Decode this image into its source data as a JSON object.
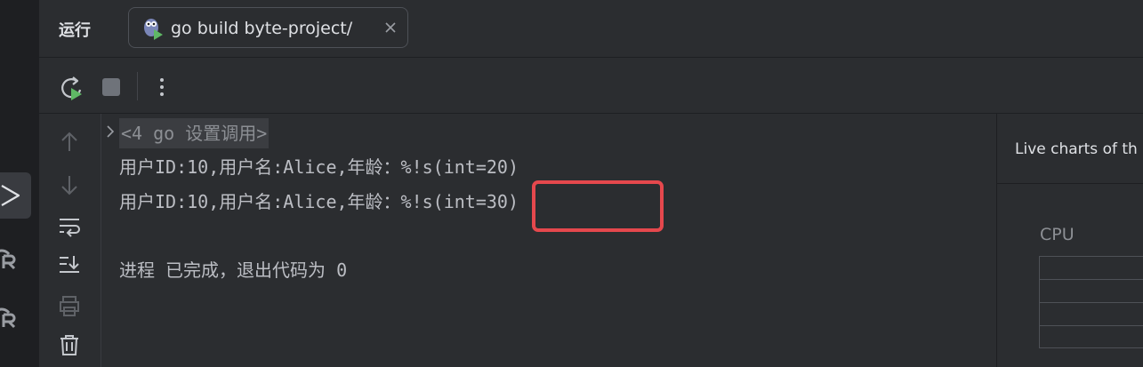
{
  "run_panel": {
    "title": "运行",
    "tab": {
      "label": "go build byte-project/"
    }
  },
  "console": {
    "collapsed_block": "<4 go 设置调用>",
    "lines": [
      "用户ID:10,用户名:Alice,年龄：%!s(int=20)",
      "用户ID:10,用户名:Alice,年龄：%!s(int=30)",
      "进程 已完成，退出代码为 0"
    ]
  },
  "live_charts": {
    "title": "Live charts of th",
    "cpu_label": "CPU"
  },
  "icons": {
    "left_strip": [
      "run-tool-window-icon",
      "coderabbit-icon",
      "coderabbit-icon"
    ],
    "toolbar": [
      "rerun-icon",
      "stop-icon",
      "more-vertical-icon"
    ],
    "side": [
      "arrow-up-icon",
      "arrow-down-icon",
      "soft-wrap-icon",
      "scroll-to-end-icon",
      "print-icon",
      "trash-icon"
    ]
  },
  "colors": {
    "background": "#2b2d30",
    "highlight": "#e5484d",
    "rerun_accent": "#5fb865"
  }
}
